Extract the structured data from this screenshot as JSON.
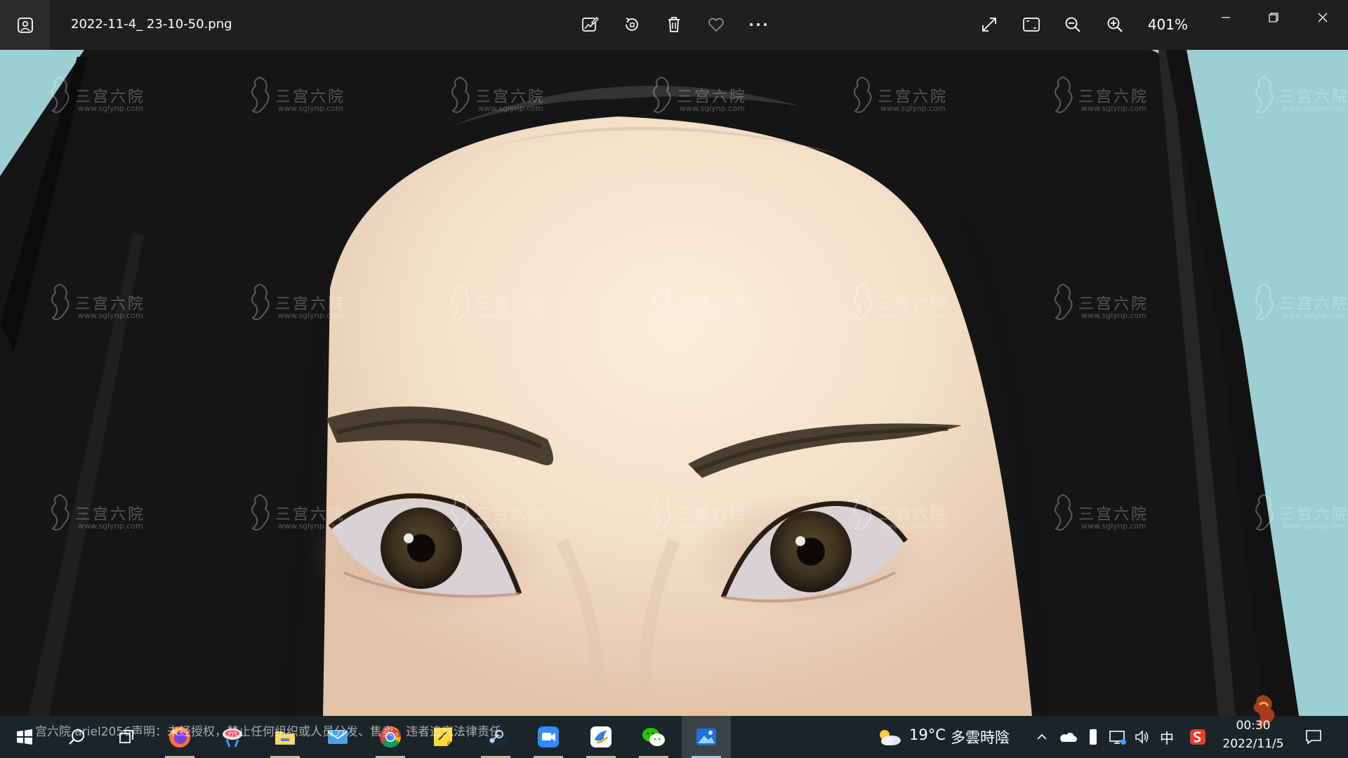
{
  "window": {
    "file_name": "2022-11-4_ 23-10-50.png",
    "zoom_level": "401%"
  },
  "toolbar": {
    "icons": [
      "edit-image-icon",
      "rotate-icon",
      "delete-icon",
      "favorite-icon",
      "more-icon"
    ],
    "right_icons": [
      "fullscreen-icon",
      "fit-to-window-icon",
      "zoom-out-icon",
      "zoom-in-icon"
    ]
  },
  "watermark": {
    "text": "三宫六院",
    "url": "www.sglynp.com"
  },
  "taskbar": {
    "overlay_notice": "宫六院 ariel2056声明：未经授权，禁止任何组织或人员分发、售卖，违者追究法律责任",
    "apps": [
      "windows-start-icon",
      "search-icon",
      "task-view-icon",
      "firefox-icon",
      "cloud-app-icon",
      "file-explorer-icon",
      "mail-icon",
      "chrome-icon",
      "sticky-notes-icon",
      "steam-icon",
      "zoom-app-icon",
      "feishu-icon",
      "wechat-icon",
      "photos-icon"
    ],
    "weather": {
      "temperature": "19°C",
      "condition": "多雲時陰"
    },
    "tray": {
      "ime_label": "中",
      "icons": [
        "show-hidden-icons-icon",
        "onedrive-icon",
        "phone-icon",
        "network-icon",
        "volume-icon",
        "ime-icon",
        "sogou-icon"
      ]
    },
    "clock": {
      "time": "00:30",
      "date": "2022/11/5"
    }
  },
  "colors": {
    "titlebar_bg": "#1f1f1f",
    "background_teal": "#9ccfd2",
    "hair_black": "#141414",
    "skin": "#f2dfc8",
    "taskbar_bg": "#1e2a30"
  }
}
